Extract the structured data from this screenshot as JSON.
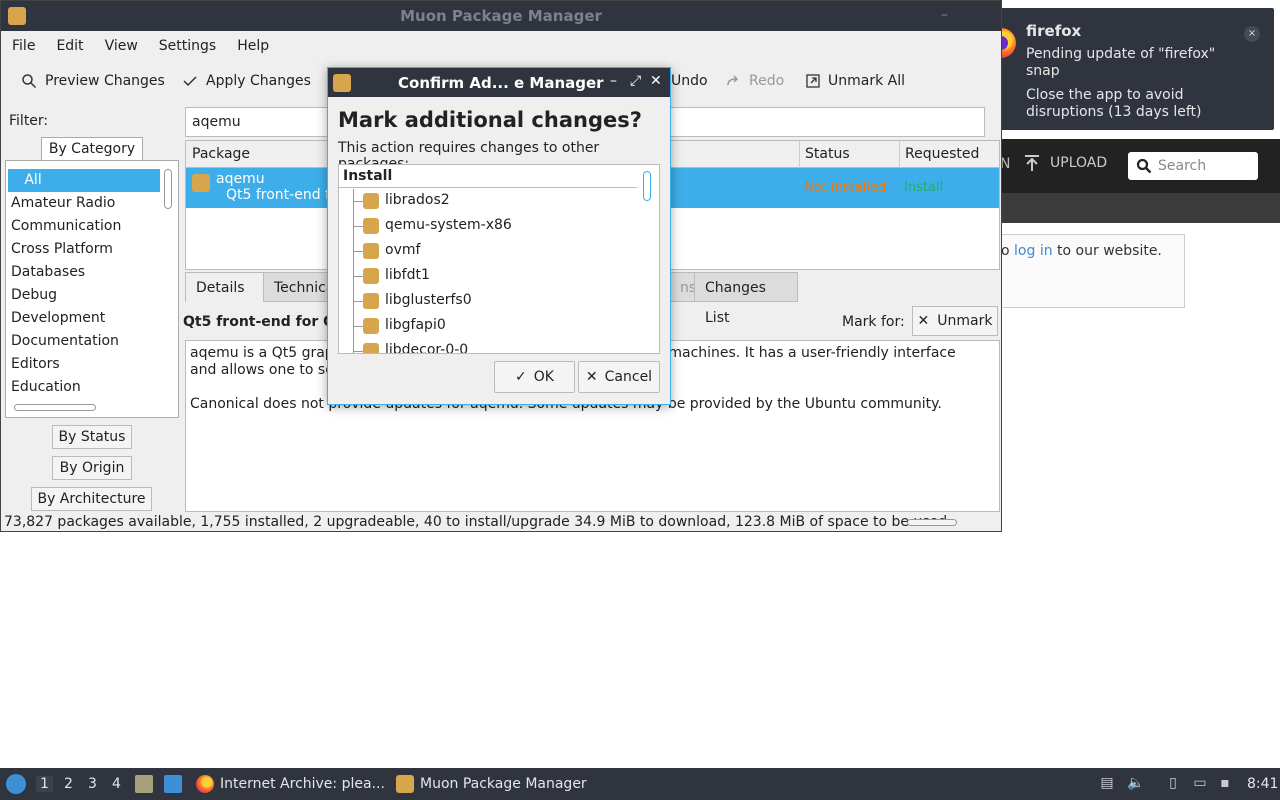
{
  "browser": {
    "nav_partial": "N",
    "upload_label": "UPLOAD",
    "search_placeholder": "Search",
    "note_prefix": "o",
    "note_link": "log in",
    "note_suffix": " to our website."
  },
  "notification": {
    "title": "firefox",
    "body1": "Pending update of \"firefox\" snap",
    "body2": "Close the app to avoid disruptions (13 days left)",
    "close": "×"
  },
  "muon": {
    "title": "Muon Package Manager",
    "menu": [
      "File",
      "Edit",
      "View",
      "Settings",
      "Help"
    ],
    "toolbar": {
      "preview": "Preview Changes",
      "apply": "Apply Changes",
      "undo": "Undo",
      "redo": "Redo",
      "unmark_all": "Unmark All"
    },
    "filter_label": "Filter:",
    "filter_value": "aqemu",
    "by_category": "By Category",
    "categories": [
      "All",
      "Amateur Radio",
      "Communication",
      "Cross Platform",
      "Databases",
      "Debug",
      "Development",
      "Documentation",
      "Editors",
      "Education"
    ],
    "by_status": "By Status",
    "by_origin": "By Origin",
    "by_architecture": "By Architecture",
    "table": {
      "col_package": "Package",
      "col_status": "Status",
      "col_requested": "Requested",
      "row": {
        "name": "aqemu",
        "desc": "Qt5 front-end f",
        "status": "Not installed",
        "requested": "Install"
      }
    },
    "details_tabs": [
      "Details",
      "Technica",
      "ns",
      "Changes List"
    ],
    "details_title": "Qt5 front-end for QE",
    "mark_for": "Mark for:",
    "unmark": "Unmark",
    "desc_line1": "aqemu is a Qt5 graph",
    "desc_line1_tail": "ual machines. It has a user-friendly interface",
    "desc_line2": "and allows one to se",
    "desc_para2": "Canonical does not provide updates for aqemu. Some updates may be provided by the Ubuntu community.",
    "statusbar": "73,827 packages available, 1,755 installed, 2 upgradeable, 40 to install/upgrade 34.9 MiB to download, 123.8 MiB of space to be used"
  },
  "dialog": {
    "title": "Confirm Ad... e Manager",
    "heading": "Mark additional changes?",
    "subtext": "This action requires changes to other packages:",
    "tree_header": "Install",
    "packages": [
      "librados2",
      "qemu-system-x86",
      "ovmf",
      "libfdt1",
      "libglusterfs0",
      "libgfapi0",
      "libdecor-0-0"
    ],
    "ok": "OK",
    "cancel": "Cancel"
  },
  "taskbar": {
    "workspaces": [
      "1",
      "2",
      "3",
      "4"
    ],
    "task_firefox": "Internet Archive: plea...",
    "task_muon": "Muon Package Manager",
    "clock": "8:41"
  }
}
